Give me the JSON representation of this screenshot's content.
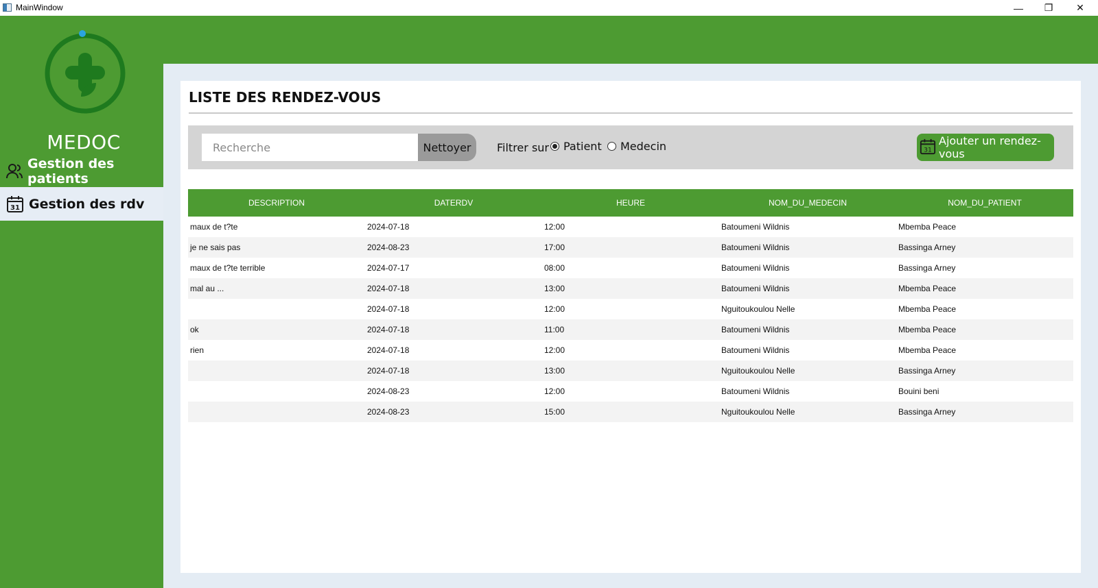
{
  "window": {
    "title": "MainWindow",
    "controls": {
      "minimize": "—",
      "maximize": "❐",
      "close": "✕"
    }
  },
  "sidebar": {
    "brand": "MEDOC",
    "nav": [
      {
        "label": "Gestion des patients",
        "icon": "users-icon",
        "active": false
      },
      {
        "label": "Gestion des rdv",
        "icon": "calendar-icon",
        "active": true
      }
    ]
  },
  "main": {
    "title": "LISTE DES RENDEZ-VOUS",
    "search": {
      "placeholder": "Recherche",
      "value": ""
    },
    "clear_label": "Nettoyer",
    "filter": {
      "label": "Filtrer sur",
      "options": [
        "Patient",
        "Medecin"
      ],
      "selected": "Patient"
    },
    "add_label": "Ajouter un rendez-vous",
    "table": {
      "columns": [
        "DESCRIPTION",
        "DATERDV",
        "HEURE",
        "NOM_DU_MEDECIN",
        "NOM_DU_PATIENT"
      ],
      "rows": [
        [
          "maux de t?te",
          "2024-07-18",
          "12:00",
          "Batoumeni Wildnis",
          "Mbemba Peace"
        ],
        [
          "je ne sais pas",
          "2024-08-23",
          "17:00",
          "Batoumeni Wildnis",
          "Bassinga Arney"
        ],
        [
          "maux de t?te terrible",
          "2024-07-17",
          "08:00",
          "Batoumeni Wildnis",
          "Bassinga Arney"
        ],
        [
          "mal au ...",
          "2024-07-18",
          "13:00",
          "Batoumeni Wildnis",
          "Mbemba Peace"
        ],
        [
          "",
          "2024-07-18",
          "12:00",
          "Nguitoukoulou Nelle",
          "Mbemba Peace"
        ],
        [
          "ok",
          "2024-07-18",
          "11:00",
          "Batoumeni Wildnis",
          "Mbemba Peace"
        ],
        [
          "rien",
          "2024-07-18",
          "12:00",
          "Batoumeni Wildnis",
          "Mbemba Peace"
        ],
        [
          "",
          "2024-07-18",
          "13:00",
          "Nguitoukoulou Nelle",
          "Bassinga Arney"
        ],
        [
          "",
          "2024-08-23",
          "12:00",
          "Batoumeni Wildnis",
          "Bouini beni"
        ],
        [
          "",
          "2024-08-23",
          "15:00",
          "Nguitoukoulou Nelle",
          "Bassinga Arney"
        ]
      ]
    }
  },
  "colors": {
    "primary_green": "#4d9b32",
    "content_bg": "#e4ecf4",
    "toolbar_bg": "#d4d4d4",
    "logo_blue": "#2aa4e0",
    "logo_dark_green": "#1e7a1e"
  }
}
